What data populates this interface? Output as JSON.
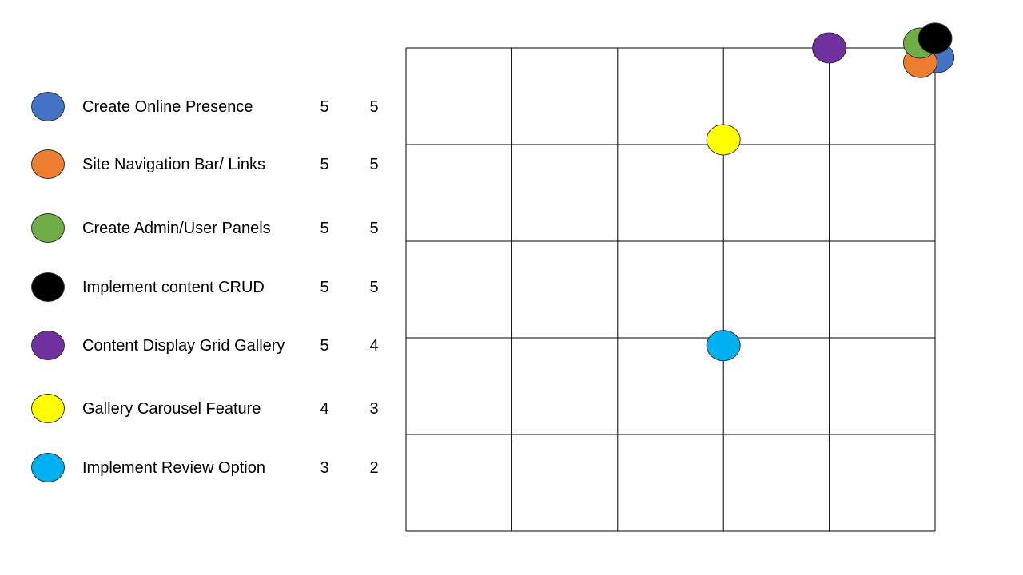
{
  "chart_data": {
    "type": "scatter",
    "title": "",
    "xlabel": "",
    "ylabel": "",
    "xlim": [
      0,
      5
    ],
    "ylim": [
      0,
      5
    ],
    "grid": true,
    "legend_position": "left",
    "series": [
      {
        "name": "Create Online Presence",
        "value_1": "5",
        "value_2": "5",
        "x": 5.02,
        "y": 4.9,
        "color": "#4472C4"
      },
      {
        "name": "Site Navigation Bar/ Links",
        "value_1": "5",
        "value_2": "5",
        "x": 4.86,
        "y": 4.85,
        "color": "#ED7D31"
      },
      {
        "name": "Create Admin/User Panels",
        "value_1": "5",
        "value_2": "5",
        "x": 4.86,
        "y": 5.05,
        "color": "#70AD47"
      },
      {
        "name": "Implement content CRUD",
        "value_1": "5",
        "value_2": "5",
        "x": 5.0,
        "y": 5.1,
        "color": "#000000"
      },
      {
        "name": "Content Display Grid Gallery",
        "value_1": "5",
        "value_2": "4",
        "x": 4.0,
        "y": 5.0,
        "color": "#7030A0"
      },
      {
        "name": "Gallery Carousel Feature",
        "value_1": "4",
        "value_2": "3",
        "x": 3.0,
        "y": 4.05,
        "color": "#FFFF00"
      },
      {
        "name": "Implement Review Option",
        "value_1": "3",
        "value_2": "2",
        "x": 3.0,
        "y": 1.92,
        "color": "#00B0F0"
      }
    ]
  }
}
